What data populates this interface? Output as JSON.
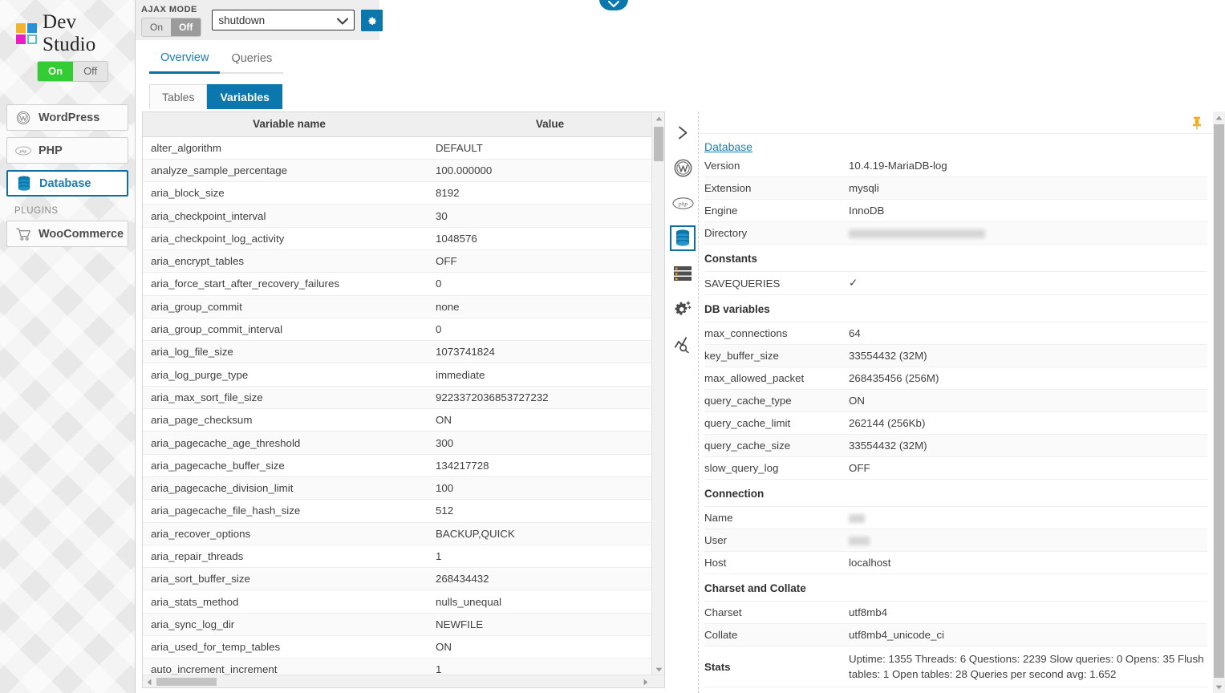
{
  "brand": {
    "name": "Dev Studio",
    "logo_colors": [
      "#f2b330",
      "#2b8fd6",
      "#e91ec9",
      "#55c7b8"
    ],
    "toggle": {
      "on": "On",
      "off": "Off",
      "state": "on"
    }
  },
  "topbar": {
    "ajax_label": "AJAX MODE",
    "ajax_toggle": {
      "on": "On",
      "off": "Off",
      "state": "off"
    },
    "select_value": "shutdown",
    "select_options": [
      "shutdown"
    ],
    "gear_title": "settings"
  },
  "sidebar": {
    "items": [
      {
        "label": "WordPress",
        "icon": "wordpress-icon",
        "active": false
      },
      {
        "label": "PHP",
        "icon": "php-icon",
        "active": false
      },
      {
        "label": "Database",
        "icon": "database-icon",
        "active": true
      }
    ],
    "group_label": "PLUGINS",
    "plugins": [
      {
        "label": "WooCommerce",
        "icon": "cart-icon",
        "active": false
      }
    ]
  },
  "tabs": {
    "main": [
      {
        "label": "Overview",
        "active": true
      },
      {
        "label": "Queries",
        "active": false
      }
    ],
    "sub": [
      {
        "label": "Tables",
        "active": false
      },
      {
        "label": "Variables",
        "active": true
      }
    ]
  },
  "variables_table": {
    "columns": [
      "Variable name",
      "Value"
    ],
    "rows": [
      [
        "alter_algorithm",
        "DEFAULT"
      ],
      [
        "analyze_sample_percentage",
        "100.000000"
      ],
      [
        "aria_block_size",
        "8192"
      ],
      [
        "aria_checkpoint_interval",
        "30"
      ],
      [
        "aria_checkpoint_log_activity",
        "1048576"
      ],
      [
        "aria_encrypt_tables",
        "OFF"
      ],
      [
        "aria_force_start_after_recovery_failures",
        "0"
      ],
      [
        "aria_group_commit",
        "none"
      ],
      [
        "aria_group_commit_interval",
        "0"
      ],
      [
        "aria_log_file_size",
        "1073741824"
      ],
      [
        "aria_log_purge_type",
        "immediate"
      ],
      [
        "aria_max_sort_file_size",
        "9223372036853727232"
      ],
      [
        "aria_page_checksum",
        "ON"
      ],
      [
        "aria_pagecache_age_threshold",
        "300"
      ],
      [
        "aria_pagecache_buffer_size",
        "134217728"
      ],
      [
        "aria_pagecache_division_limit",
        "100"
      ],
      [
        "aria_pagecache_file_hash_size",
        "512"
      ],
      [
        "aria_recover_options",
        "BACKUP,QUICK"
      ],
      [
        "aria_repair_threads",
        "1"
      ],
      [
        "aria_sort_buffer_size",
        "268434432"
      ],
      [
        "aria_stats_method",
        "nulls_unequal"
      ],
      [
        "aria_sync_log_dir",
        "NEWFILE"
      ],
      [
        "aria_used_for_temp_tables",
        "ON"
      ],
      [
        "auto_increment_increment",
        "1"
      ]
    ]
  },
  "icon_rail": [
    {
      "icon": "chevron-right-icon",
      "active": false
    },
    {
      "icon": "wordpress-icon",
      "active": false
    },
    {
      "icon": "php-icon",
      "active": false
    },
    {
      "icon": "database-icon",
      "active": true
    },
    {
      "icon": "server-list-icon",
      "active": false
    },
    {
      "icon": "gear-plus-icon",
      "active": false
    },
    {
      "icon": "analytics-search-icon",
      "active": false
    }
  ],
  "detail": {
    "pin_icon": "pushpin-icon",
    "title": "Database",
    "sections": [
      {
        "heading": null,
        "rows": [
          {
            "key": "Version",
            "value": "10.4.19-MariaDB-log",
            "type": "text"
          },
          {
            "key": "Extension",
            "value": "mysqli",
            "type": "text"
          },
          {
            "key": "Engine",
            "value": "InnoDB",
            "type": "text"
          },
          {
            "key": "Directory",
            "value": "",
            "type": "redacted",
            "redact_width": 170
          }
        ]
      },
      {
        "heading": "Constants",
        "rows": [
          {
            "key": "SAVEQUERIES",
            "value": "✓",
            "type": "check"
          }
        ]
      },
      {
        "heading": "DB variables",
        "rows": [
          {
            "key": "max_connections",
            "value": "64",
            "type": "text"
          },
          {
            "key": "key_buffer_size",
            "value": "33554432 (32M)",
            "type": "text"
          },
          {
            "key": "max_allowed_packet",
            "value": "268435456 (256M)",
            "type": "text"
          },
          {
            "key": "query_cache_type",
            "value": "ON",
            "type": "text"
          },
          {
            "key": "query_cache_limit",
            "value": "262144 (256Kb)",
            "type": "text"
          },
          {
            "key": "query_cache_size",
            "value": "33554432 (32M)",
            "type": "text"
          },
          {
            "key": "slow_query_log",
            "value": "OFF",
            "type": "text"
          }
        ]
      },
      {
        "heading": "Connection",
        "rows": [
          {
            "key": "Name",
            "value": "",
            "type": "redacted",
            "redact_width": 20
          },
          {
            "key": "User",
            "value": "",
            "type": "redacted",
            "redact_width": 26
          },
          {
            "key": "Host",
            "value": "localhost",
            "type": "text"
          }
        ]
      },
      {
        "heading": "Charset and Collate",
        "rows": [
          {
            "key": "Charset",
            "value": "utf8mb4",
            "type": "text"
          },
          {
            "key": "Collate",
            "value": "utf8mb4_unicode_ci",
            "type": "text"
          },
          {
            "key": "Stats",
            "value": "Uptime: 1355 Threads: 6 Questions: 2239 Slow queries: 0 Opens: 35 Flush tables: 1 Open tables: 28 Queries per second avg: 1.652",
            "type": "stats"
          }
        ]
      }
    ]
  },
  "colors": {
    "accent_blue": "#0b77ad",
    "accent_blue_dark": "#0b6fa4",
    "link_blue": "#1b7fb5",
    "green_on": "#33cc33",
    "check_green": "#2aa02a",
    "pin_yellow": "#f0ad28"
  }
}
